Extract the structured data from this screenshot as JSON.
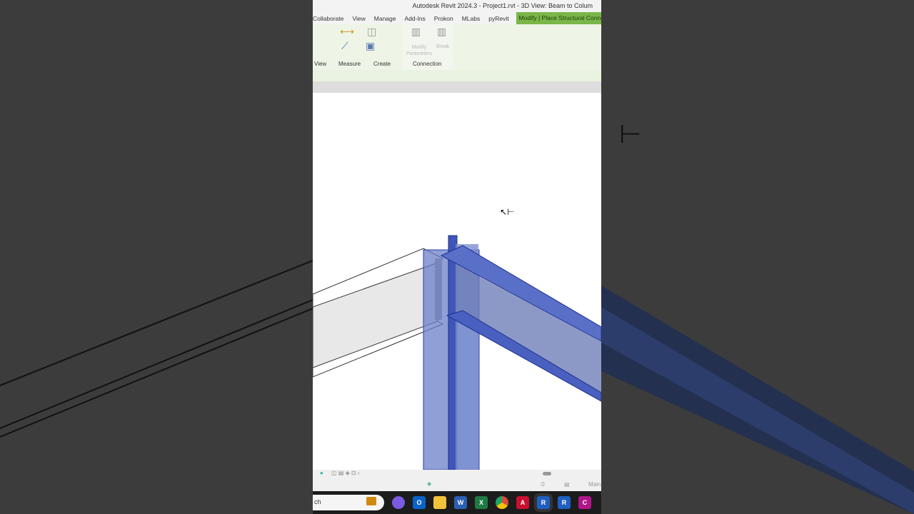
{
  "window": {
    "title": "Autodesk Revit 2024.3 - Project1.rvt - 3D View: Beam to Colum"
  },
  "tabs": [
    "Collaborate",
    "View",
    "Manage",
    "Add-Ins",
    "Prokon",
    "MLabs",
    "pyRevit"
  ],
  "active_tab": "Modify | Place Structural Connectio",
  "ribbon": {
    "panels": [
      "View",
      "Measure",
      "Create",
      "Connection"
    ],
    "buttons": {
      "modify_parameters": "Modify Parameters",
      "break": "Break"
    }
  },
  "status": {
    "count": ":0",
    "workset": "Main"
  },
  "taskbar": {
    "search": "ch",
    "apps": [
      {
        "name": "outlook",
        "label": "O",
        "color": "#0a64c8"
      },
      {
        "name": "file-explorer",
        "label": "",
        "color": "#f3c23c"
      },
      {
        "name": "word",
        "label": "W",
        "color": "#2b5fb3"
      },
      {
        "name": "excel",
        "label": "X",
        "color": "#1e7a44"
      },
      {
        "name": "chrome",
        "label": "",
        "color": "#dd4b39"
      },
      {
        "name": "autocad",
        "label": "A",
        "color": "#c8102e"
      },
      {
        "name": "revit",
        "label": "R",
        "color": "#1f5fbf"
      },
      {
        "name": "revit-2",
        "label": "R",
        "color": "#1f5fbf"
      },
      {
        "name": "civil3d",
        "label": "C",
        "color": "#b0168a"
      }
    ]
  }
}
